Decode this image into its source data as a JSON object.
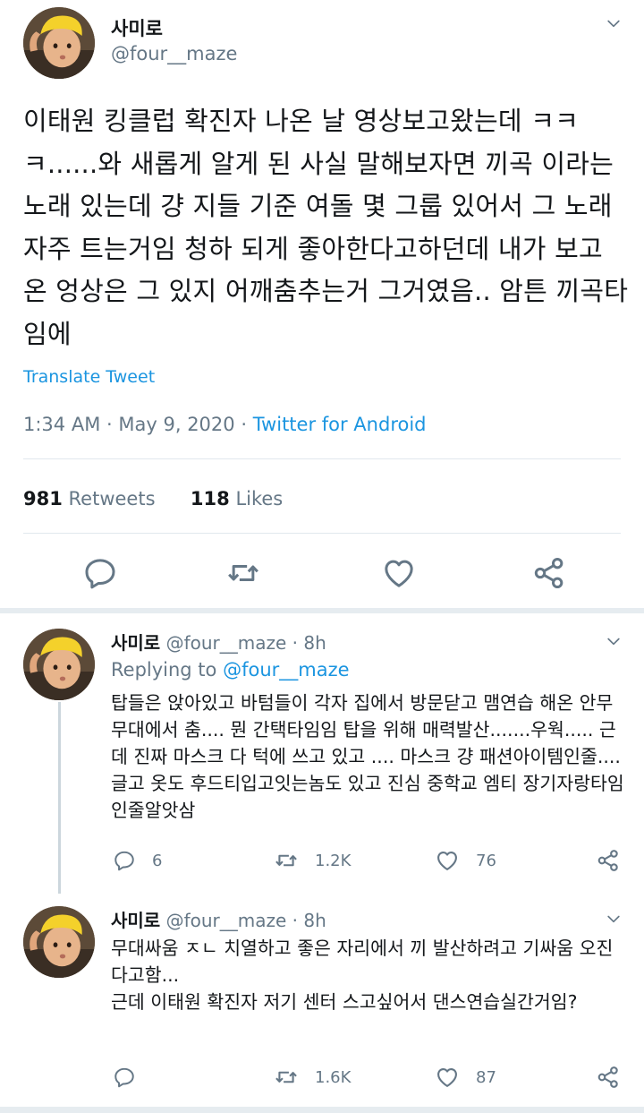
{
  "main_tweet": {
    "display_name": "사미로",
    "handle": "@four__maze",
    "text": "이태원 킹클럽 확진자 나온 날 영상보고왔는데 ㅋㅋㅋ......와 새롭게 알게 된 사실 말해보자면 끼곡 이라는 노래 있는데 걍 지들 기준 여돌 몇 그룹 있어서 그 노래 자주 트는거임 청하 되게 좋아한다고하던데 내가 보고 온 엉상은 그 있지 어깨춤추는거 그거였음.. 암튼 끼곡타임에",
    "translate_label": "Translate Tweet",
    "time": "1:34 AM",
    "date": "May 9, 2020",
    "dot1": "·",
    "dot2": "·",
    "source": "Twitter for Android",
    "retweets_count": "981",
    "retweets_label": "Retweets",
    "likes_count": "118",
    "likes_label": "Likes"
  },
  "replies": [
    {
      "display_name": "사미로",
      "handle": "@four__maze",
      "dot": "·",
      "age": "8h",
      "replying_prefix": "Replying to",
      "replying_handle": "@four__maze",
      "text": "탑들은 앉아있고 바텀들이 각자 집에서 방문닫고 맴연습 해온 안무 무대에서 춤.... 뭔 간택타임임 탑을 위해 매력발산.......우웍..... 근데 진짜 마스크 다 턱에 쓰고 있고 .... 마스크 걍 패션아이템인줄.... 글고 옷도 후드티입고잇는놈도 있고 진심 중학교 엠티 장기자랑타임인줄알앗삼",
      "reply_count": "6",
      "retweet_count": "1.2K",
      "like_count": "76"
    },
    {
      "display_name": "사미로",
      "handle": "@four__maze",
      "dot": "·",
      "age": "8h",
      "text_line1": "무대싸움 ㅈㄴ 치열하고 좋은 자리에서 끼 발산하려고 기싸움 오진다고함...",
      "text_line2": "근데 이태원 확진자 저기 센터 스고싶어서 댄스연습실간거임?",
      "reply_count": "",
      "retweet_count": "1.6K",
      "like_count": "87"
    }
  ],
  "icons": {
    "caret": "chevron-down-icon",
    "reply": "reply-icon",
    "retweet": "retweet-icon",
    "like": "heart-icon",
    "share": "share-icon"
  },
  "colors": {
    "link": "#1b95e0",
    "secondary_text": "#657786",
    "divider": "#e1e8ed",
    "icon": "#657786"
  }
}
